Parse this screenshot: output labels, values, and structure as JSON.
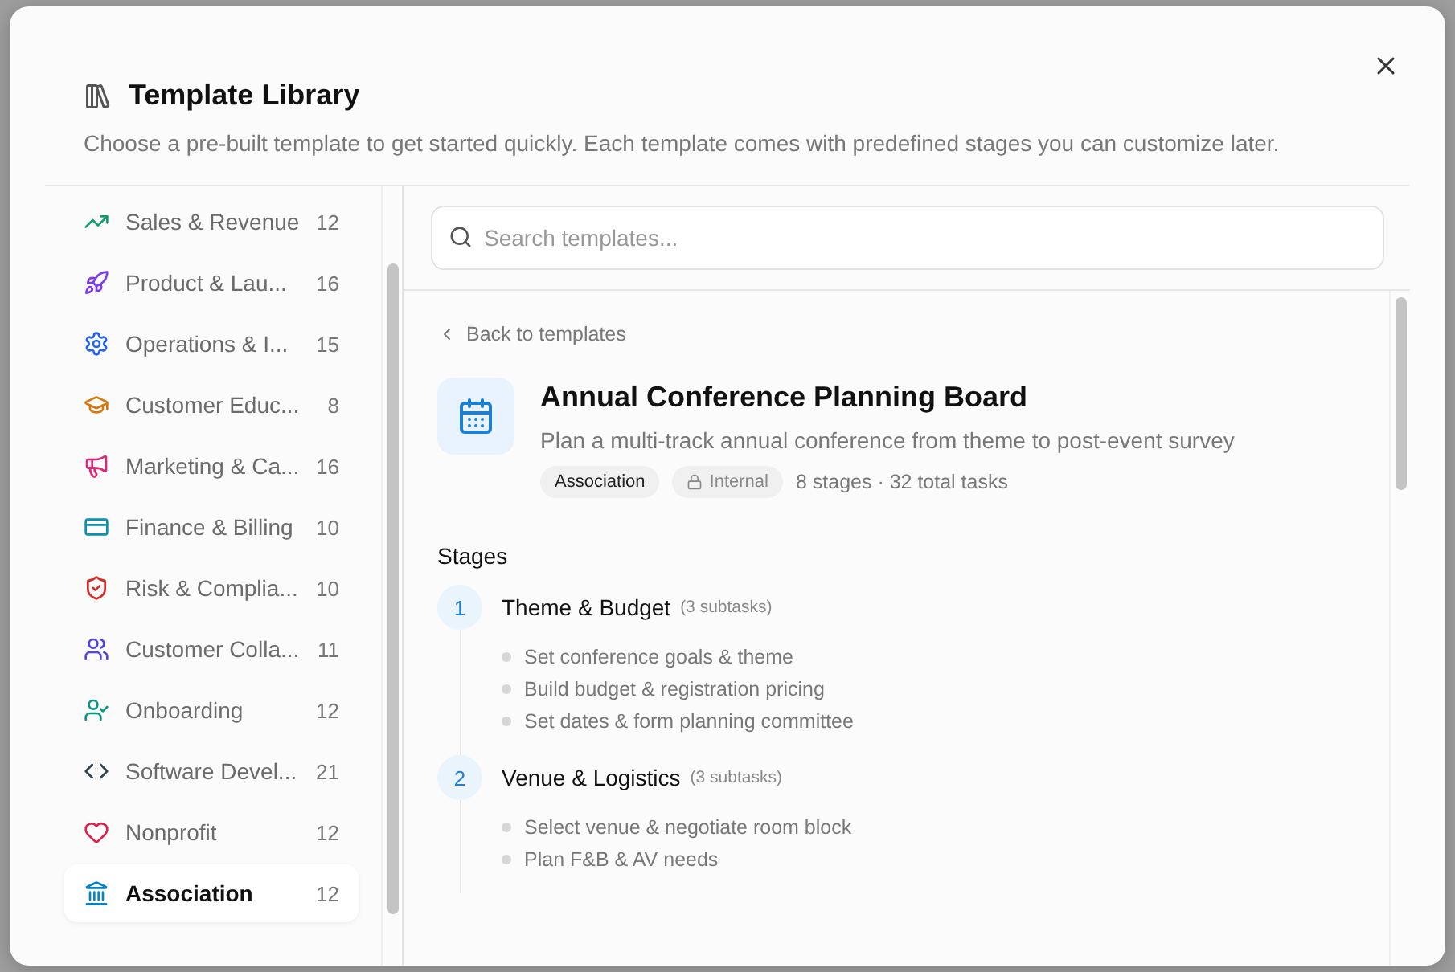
{
  "dialog": {
    "title": "Template Library",
    "subtitle": "Choose a pre-built template to get started quickly. Each template comes with predefined stages you can customize later."
  },
  "sidebar": {
    "items": [
      {
        "label": "Sales & Revenue",
        "count": "12",
        "selected": false
      },
      {
        "label": "Product & Lau...",
        "count": "16",
        "selected": false
      },
      {
        "label": "Operations & I...",
        "count": "15",
        "selected": false
      },
      {
        "label": "Customer Educ...",
        "count": "8",
        "selected": false
      },
      {
        "label": "Marketing & Ca...",
        "count": "16",
        "selected": false
      },
      {
        "label": "Finance & Billing",
        "count": "10",
        "selected": false
      },
      {
        "label": "Risk & Complia...",
        "count": "10",
        "selected": false
      },
      {
        "label": "Customer Colla...",
        "count": "11",
        "selected": false
      },
      {
        "label": "Onboarding",
        "count": "12",
        "selected": false
      },
      {
        "label": "Software Devel...",
        "count": "21",
        "selected": false
      },
      {
        "label": "Nonprofit",
        "count": "12",
        "selected": false
      },
      {
        "label": "Association",
        "count": "12",
        "selected": true
      }
    ]
  },
  "search": {
    "placeholder": "Search templates..."
  },
  "detail": {
    "back_link": "Back to templates",
    "title": "Annual Conference Planning Board",
    "description": "Plan a multi-track annual conference from theme to post-event survey",
    "tags": [
      {
        "label": "Association",
        "kind": "category"
      },
      {
        "label": "Internal",
        "kind": "visibility"
      }
    ],
    "summary": "8 stages · 32 total tasks",
    "stages_heading": "Stages",
    "stages": [
      {
        "number": "1",
        "name": "Theme & Budget",
        "subtask_count": "(3 subtasks)",
        "tasks": [
          "Set conference goals & theme",
          "Build budget & registration pricing",
          "Set dates & form planning committee"
        ]
      },
      {
        "number": "2",
        "name": "Venue & Logistics",
        "subtask_count": "(3 subtasks)",
        "tasks": [
          "Select venue & negotiate room block",
          "Plan F&B & AV needs"
        ]
      }
    ]
  }
}
